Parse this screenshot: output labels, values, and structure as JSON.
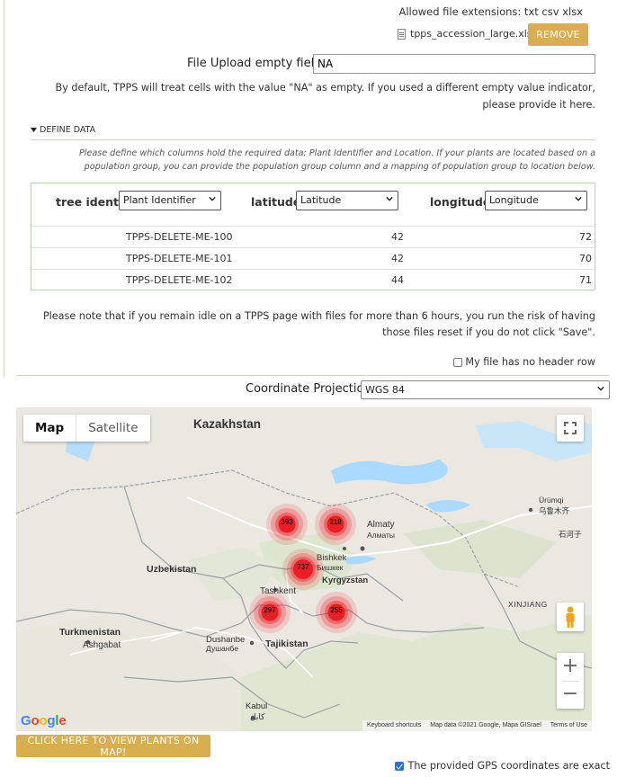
{
  "upload": {
    "allowed_extensions": "Allowed file extensions: txt csv xlsx",
    "file_name": "tpps_accession_large.xlsx",
    "remove_label": "REMOVE",
    "empty_field_label": "File Upload empty field:",
    "empty_field_value": "NA",
    "empty_field_help": "By default, TPPS will treat cells with the value \"NA\" as empty. If you used a different empty value indicator, please provide it here."
  },
  "define": {
    "header": "DEFINE DATA",
    "help": "Please define which columns hold the required data: Plant Identifier and Location. If your plants are located based on a population group, you can provide the population group column and a mapping of population group to location below.",
    "columns": [
      {
        "header": "tree identif",
        "selected": "Plant Identifier"
      },
      {
        "header": "latitude",
        "selected": "Latitude"
      },
      {
        "header": "longitude",
        "selected": "Longitude"
      }
    ],
    "rows": [
      {
        "id": "TPPS-DELETE-ME-100",
        "lat": "42",
        "lon": "72"
      },
      {
        "id": "TPPS-DELETE-ME-101",
        "lat": "42",
        "lon": "70"
      },
      {
        "id": "TPPS-DELETE-ME-102",
        "lat": "44",
        "lon": "71"
      }
    ]
  },
  "note": "Please note that if you remain idle on a TPPS page with files for more than 6 hours, you run the risk of having those files reset if you do not click \"Save\".",
  "no_header_label": "My file has no header row",
  "no_header_checked": false,
  "projection": {
    "label": "Coordinate Projection",
    "selected": "WGS 84"
  },
  "map": {
    "type_tabs": [
      "Map",
      "Satellite"
    ],
    "active_tab": "Map",
    "places": {
      "kazakhstan": "Kazakhstan",
      "uzbekistan": "Uzbekistan",
      "turkmenistan": "Turkmenistan",
      "ashgabat": "Ashgabat",
      "tajikistan": "Tajikistan",
      "kyrgyzstan": "Kyrgyzstan",
      "bishkek": "Bishkek",
      "bishkek_cyr": "Бишкек",
      "almaty": "Almaty",
      "almaty_cyr": "Алматы",
      "tashkent": "Tashkent",
      "dushanbe": "Dushanbe",
      "dushanbe_cyr": "Душанбе",
      "kabul": "Kabul",
      "kabul_ar": "کابل",
      "urumqi": "Ürümqi",
      "urumqi_cn": "乌鲁木齐",
      "xinjiang": "XINJIANG",
      "shihezi_cn": "石河子"
    },
    "clusters": [
      {
        "count": "393"
      },
      {
        "count": "318"
      },
      {
        "count": "737"
      },
      {
        "count": "297"
      },
      {
        "count": "255"
      }
    ],
    "cluster_color": "#ee1c24",
    "logo": "Google",
    "attribution": [
      "Keyboard shortcuts",
      "Map data ©2021 Google, Mapa GISrael",
      "Terms of Use"
    ],
    "icons": [
      "fullscreen-icon",
      "pegman-icon",
      "zoom-in-icon",
      "zoom-out-icon"
    ]
  },
  "view_map_label": "CLICK HERE TO VIEW PLANTS ON MAP!",
  "gps_exact_label": "The provided GPS coordinates are exact",
  "gps_exact_checked": true,
  "colors": {
    "accent_gold": "#d8ae4f",
    "rule_green": "#c8dcc4"
  }
}
